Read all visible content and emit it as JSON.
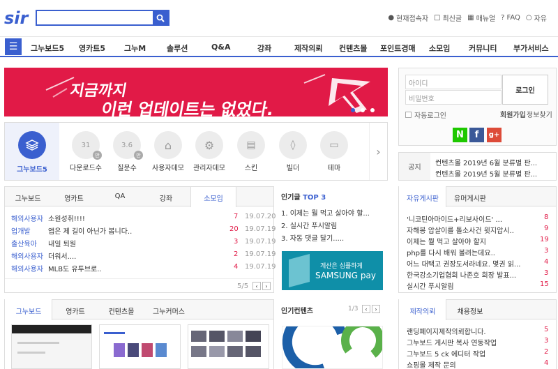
{
  "header": {
    "logo_text": "sir",
    "search_placeholder": "",
    "toplinks": [
      {
        "icon": "person-icon",
        "label": "현재접속자"
      },
      {
        "icon": "document-icon",
        "label": "최신글"
      },
      {
        "icon": "book-icon",
        "label": "매뉴얼"
      },
      {
        "icon": "question-icon",
        "label": "FAQ"
      },
      {
        "icon": "chat-icon",
        "label": "자유"
      }
    ]
  },
  "nav": {
    "items": [
      "그누보드5",
      "영카트5",
      "그누M",
      "솔루션",
      "Q&A",
      "강좌",
      "제작의뢰",
      "컨텐츠몰",
      "포인트경매",
      "소모임",
      "커뮤니티",
      "부가서비스"
    ]
  },
  "banner": {
    "line1": "지금까지",
    "line2": "이런 업데이트는 없었다."
  },
  "login": {
    "id_placeholder": "아이디",
    "pw_placeholder": "비밀번호",
    "login_label": "로그인",
    "auto_login": "자동로그인",
    "join": "회원가입",
    "find": "정보찾기"
  },
  "iconrow": {
    "active_label": "그누보드5",
    "items": [
      {
        "value": "31",
        "sub": "만",
        "label": "다운로드수"
      },
      {
        "value": "3.6",
        "sub": "만",
        "label": "질문수"
      },
      {
        "value": "",
        "sub": "",
        "label": "사용자데모"
      },
      {
        "value": "",
        "sub": "",
        "label": "관리자데모"
      },
      {
        "value": "",
        "sub": "",
        "label": "스킨"
      },
      {
        "value": "",
        "sub": "",
        "label": "빌더"
      },
      {
        "value": "",
        "sub": "",
        "label": "테마"
      }
    ]
  },
  "notice": {
    "label": "공지",
    "items": [
      "컨텐츠몰 2019년 6월 분류별 판...",
      "컨텐츠몰 2019년 5월 분류별 판..."
    ]
  },
  "board1": {
    "tabs": [
      "그누보드",
      "영카트",
      "QA",
      "강좌",
      "소모임"
    ],
    "rows": [
      {
        "cat": "해외사용자",
        "title": "소원성취!!!!",
        "count": "7",
        "date": "19.07.20"
      },
      {
        "cat": "업개발",
        "title": "앱은 제 길이 아닌가 봅니다..",
        "count": "20",
        "date": "19.07.19"
      },
      {
        "cat": "출산육아",
        "title": "내일 퇴원",
        "count": "3",
        "date": "19.07.19"
      },
      {
        "cat": "해외사용자",
        "title": "더워서....",
        "count": "2",
        "date": "19.07.19"
      },
      {
        "cat": "해외사용자",
        "title": "MLB도 유투브로..",
        "count": "4",
        "date": "19.07.19"
      }
    ],
    "page": "5/5"
  },
  "popular": {
    "title": "인기글",
    "title_accent": "TOP 3",
    "items": [
      "1. 이제는 뭘 먹고 살아야 할...",
      "2. 실시간 푸시알림",
      "3. 자동 댓글 달기....."
    ],
    "ad_line": "계산은 심플하게",
    "ad_brand": "SAMSUNG pay"
  },
  "freeboard": {
    "tabs": [
      "자유게시판",
      "유머게시판"
    ],
    "rows": [
      {
        "title": "'니코틴아마이드+리보사이드' ...",
        "count": "8"
      },
      {
        "title": "자해봉 압살이를 톨소사건 윗지압시..",
        "count": "9"
      },
      {
        "title": "이제는 뭘 먹고 살아야 할지",
        "count": "19"
      },
      {
        "title": "php를 다시 배워 볼려는데요..",
        "count": "3"
      },
      {
        "title": "어느 대택고 권장도서라네요. 몇권 읽...",
        "count": "4"
      },
      {
        "title": "한국강소기업협회 나존호 회장 발표...",
        "count": "3"
      },
      {
        "title": "실시간 푸시알림",
        "count": "15"
      }
    ]
  },
  "board2": {
    "tabs": [
      "그누보드",
      "영카트",
      "컨텐츠몰",
      "그누커머스"
    ]
  },
  "popular_contents": {
    "title": "인기컨텐츠",
    "page": "1/3"
  },
  "request": {
    "tabs": [
      "제작의뢰",
      "채용정보"
    ],
    "rows": [
      {
        "title": "랜딩페이지제작의뢰합니다.",
        "count": "5"
      },
      {
        "title": "그누보드 게시판 복사 연동작업",
        "count": "3"
      },
      {
        "title": "그누보드 5 ck 에디터 작업",
        "count": "2"
      },
      {
        "title": "쇼핑몰 제작 문의",
        "count": "4"
      }
    ]
  }
}
